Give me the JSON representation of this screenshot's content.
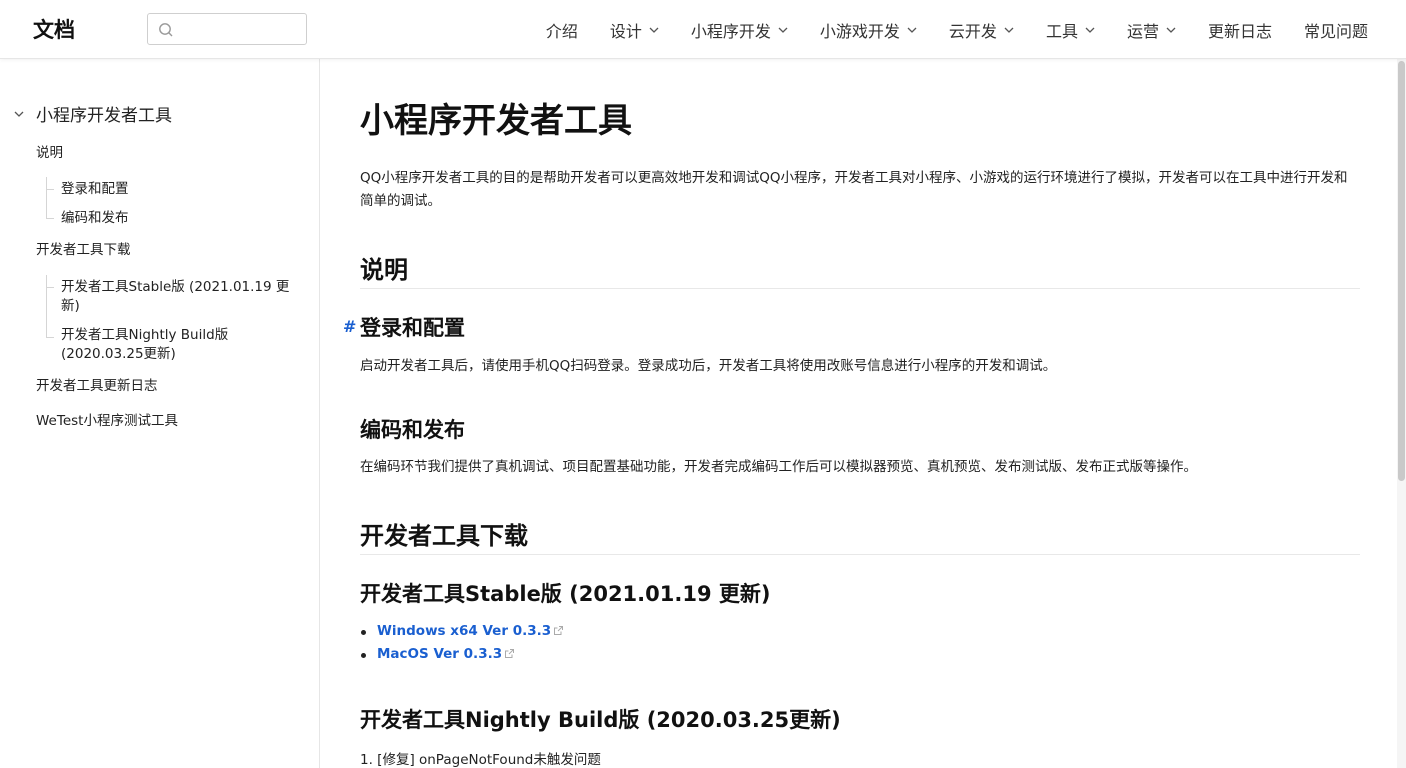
{
  "header": {
    "logo": "文档",
    "search": {
      "placeholder": ""
    },
    "nav": [
      {
        "label": "介绍",
        "dropdown": false
      },
      {
        "label": "设计",
        "dropdown": true
      },
      {
        "label": "小程序开发",
        "dropdown": true
      },
      {
        "label": "小游戏开发",
        "dropdown": true
      },
      {
        "label": "云开发",
        "dropdown": true
      },
      {
        "label": "工具",
        "dropdown": true
      },
      {
        "label": "运营",
        "dropdown": true
      },
      {
        "label": "更新日志",
        "dropdown": false
      },
      {
        "label": "常见问题",
        "dropdown": false
      }
    ]
  },
  "sidebar": {
    "root": "小程序开发者工具",
    "items": [
      {
        "label": "说明",
        "children": [
          "登录和配置",
          "编码和发布"
        ]
      },
      {
        "label": "开发者工具下载",
        "children": [
          "开发者工具Stable版 (2021.01.19 更新)",
          "开发者工具Nightly Build版 (2020.03.25更新)"
        ]
      },
      {
        "label": "开发者工具更新日志",
        "children": []
      },
      {
        "label": "WeTest小程序测试工具",
        "children": []
      }
    ]
  },
  "main": {
    "title": "小程序开发者工具",
    "intro": "QQ小程序开发者工具的目的是帮助开发者可以更高效地开发和调试QQ小程序，开发者工具对小程序、小游戏的运行环境进行了模拟，开发者可以在工具中进行开发和简单的调试。",
    "section_explain": {
      "heading": "说明",
      "login": {
        "anchor": "#",
        "heading": "登录和配置",
        "text": "启动开发者工具后，请使用手机QQ扫码登录。登录成功后，开发者工具将使用改账号信息进行小程序的开发和调试。"
      },
      "coding": {
        "heading": "编码和发布",
        "text": "在编码环节我们提供了真机调试、项目配置基础功能，开发者完成编码工作后可以模拟器预览、真机预览、发布测试版、发布正式版等操作。"
      }
    },
    "section_download": {
      "heading": "开发者工具下载",
      "stable": {
        "heading": "开发者工具Stable版 (2021.01.19 更新)",
        "links": [
          "Windows x64 Ver 0.3.3",
          "MacOS Ver 0.3.3"
        ]
      },
      "nightly": {
        "heading": "开发者工具Nightly Build版 (2020.03.25更新)",
        "item1": "1. [修复] onPageNotFound未触发问题"
      }
    }
  },
  "colors": {
    "link": "#1a5fd0",
    "text": "#222222",
    "border": "#e6e6e6"
  }
}
